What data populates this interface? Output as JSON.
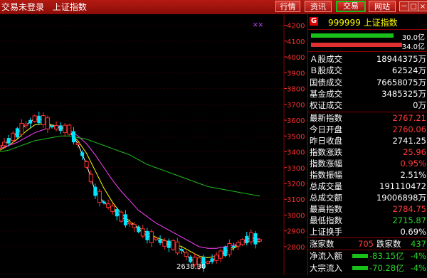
{
  "titlebar": {
    "status": "交易未登录",
    "index_name": "上证指数",
    "buttons": [
      "行情",
      "资讯",
      "交易",
      "网站"
    ],
    "window_controls": [
      "－",
      "□",
      "×"
    ]
  },
  "chart": {
    "y_ticks": [
      "4200",
      "4100",
      "4000",
      "3900",
      "3800",
      "3700",
      "3600",
      "3500",
      "3400",
      "3300",
      "3200",
      "3100",
      "3000",
      "2900",
      "2800"
    ],
    "low_label": "2638.30"
  },
  "chart_data": {
    "type": "candlestick",
    "ylim": [
      2620,
      4270
    ],
    "low_annotation": 2638.3,
    "ma_lines": [
      {
        "color": "#ffffff",
        "values": [
          3430,
          3470,
          3520,
          3570,
          3610,
          3600,
          3560,
          3550,
          3540,
          3450,
          3320,
          3150,
          3080,
          3040,
          2990,
          2950,
          2910,
          2870,
          2850,
          2820,
          2810,
          2780,
          2720,
          2700,
          2700,
          2730,
          2770,
          2800,
          2830,
          2860,
          2840
        ]
      },
      {
        "color": "#ffff00",
        "values": [
          3410,
          3440,
          3480,
          3530,
          3570,
          3580,
          3570,
          3560,
          3520,
          3470,
          3390,
          3280,
          3170,
          3080,
          3010,
          2960,
          2920,
          2890,
          2860,
          2840,
          2820,
          2800,
          2770,
          2740,
          2730,
          2740,
          2760,
          2790,
          2820,
          2840,
          2830
        ]
      },
      {
        "color": "#ff40ff",
        "values": [
          3420,
          3440,
          3460,
          3490,
          3520,
          3540,
          3560,
          3560,
          3540,
          3500,
          3450,
          3380,
          3300,
          3220,
          3150,
          3090,
          3030,
          2990,
          2950,
          2920,
          2890,
          2860,
          2830,
          2800,
          2790,
          2790,
          2800,
          2810,
          2830,
          2850,
          2850
        ]
      },
      {
        "color": "#20c020",
        "values": [
          3400,
          3410,
          3430,
          3450,
          3470,
          3480,
          3490,
          3500,
          3500,
          3490,
          3480,
          3460,
          3440,
          3420,
          3400,
          3380,
          3350,
          3320,
          3300,
          3280,
          3260,
          3240,
          3220,
          3200,
          3180,
          3170,
          3160,
          3150,
          3140,
          3130,
          3120
        ]
      }
    ]
  },
  "panel": {
    "code_title": "999999 上证指数",
    "bars": [
      {
        "label": "30.0亿",
        "color": "#19c019",
        "fraction": 0.75
      },
      {
        "label": "34.0亿",
        "color": "#e03030",
        "fraction": 0.85
      }
    ],
    "volume_rows": [
      {
        "label": "Ａ股成交",
        "value": "18944375万"
      },
      {
        "label": "Ｂ股成交",
        "value": "62524万"
      },
      {
        "label": "国债成交",
        "value": "76658075万"
      },
      {
        "label": "基金成交",
        "value": "3485325万"
      },
      {
        "label": "权证成交",
        "value": "0万"
      }
    ],
    "index_rows": [
      {
        "label": "最新指数",
        "value": "2767.21",
        "color": "red"
      },
      {
        "label": "今日开盘",
        "value": "2760.06",
        "color": "red"
      },
      {
        "label": "昨日收盘",
        "value": "2741.25",
        "color": "white"
      },
      {
        "label": "指数涨跌",
        "value": "25.96",
        "color": "red"
      },
      {
        "label": "指数涨幅",
        "value": "0.95%",
        "color": "red"
      },
      {
        "label": "指数振幅",
        "value": "2.51%",
        "color": "white"
      },
      {
        "label": "总成交量",
        "value": "191110472",
        "color": "white"
      },
      {
        "label": "总成交额",
        "value": "19006898万",
        "color": "white"
      },
      {
        "label": "最高指数",
        "value": "2784.75",
        "color": "red"
      },
      {
        "label": "最低指数",
        "value": "2715.87",
        "color": "green"
      },
      {
        "label": "上证换手",
        "value": "0.69%",
        "color": "white"
      }
    ],
    "breadth": {
      "up_label": "涨家数",
      "up_value": "705",
      "down_label": "跌家数",
      "down_value": "437"
    },
    "flows": [
      {
        "label": "净流入额",
        "value": "-83.15亿",
        "pct": "-4%"
      },
      {
        "label": "大宗流入",
        "value": "-70.28亿",
        "pct": "-4%"
      }
    ]
  }
}
